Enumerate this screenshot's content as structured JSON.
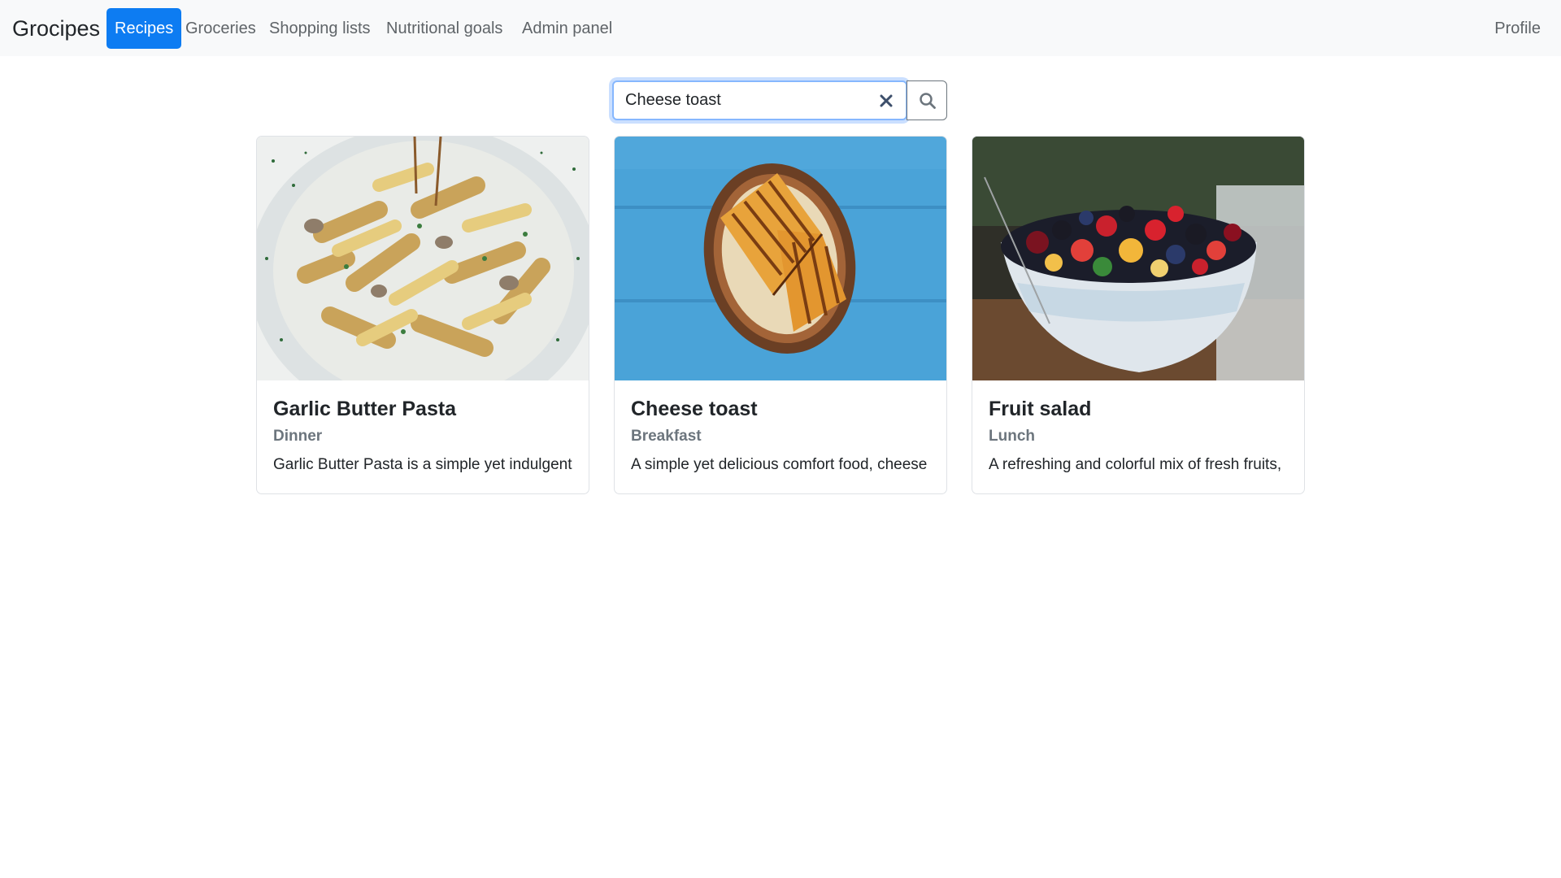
{
  "navbar": {
    "brand": "Grocipes",
    "items": [
      {
        "label": "Recipes",
        "active": true
      },
      {
        "label": "Groceries",
        "active": false
      },
      {
        "label": "Shopping lists",
        "active": false
      },
      {
        "label": "Nutritional goals",
        "active": false
      },
      {
        "label": "Admin panel",
        "active": false
      }
    ],
    "profile_label": "Profile"
  },
  "search": {
    "value": "Cheese toast",
    "clear_icon": "close-icon",
    "button_icon": "search-icon"
  },
  "recipes": [
    {
      "title": "Garlic Butter Pasta",
      "category": "Dinner",
      "description": "Garlic Butter Pasta is a simple yet indulgent",
      "image": "pasta-dish-image"
    },
    {
      "title": "Cheese toast",
      "category": "Breakfast",
      "description": "A simple yet delicious comfort food, cheese",
      "image": "grilled-toast-image"
    },
    {
      "title": "Fruit salad",
      "category": "Lunch",
      "description": "A refreshing and colorful mix of fresh fruits,",
      "image": "fruit-bowl-image"
    }
  ],
  "colors": {
    "primary": "#0d7cf2",
    "navbar_bg": "#f8f9fa",
    "muted_text": "#6c757d",
    "focus_border": "#86b7fe"
  }
}
